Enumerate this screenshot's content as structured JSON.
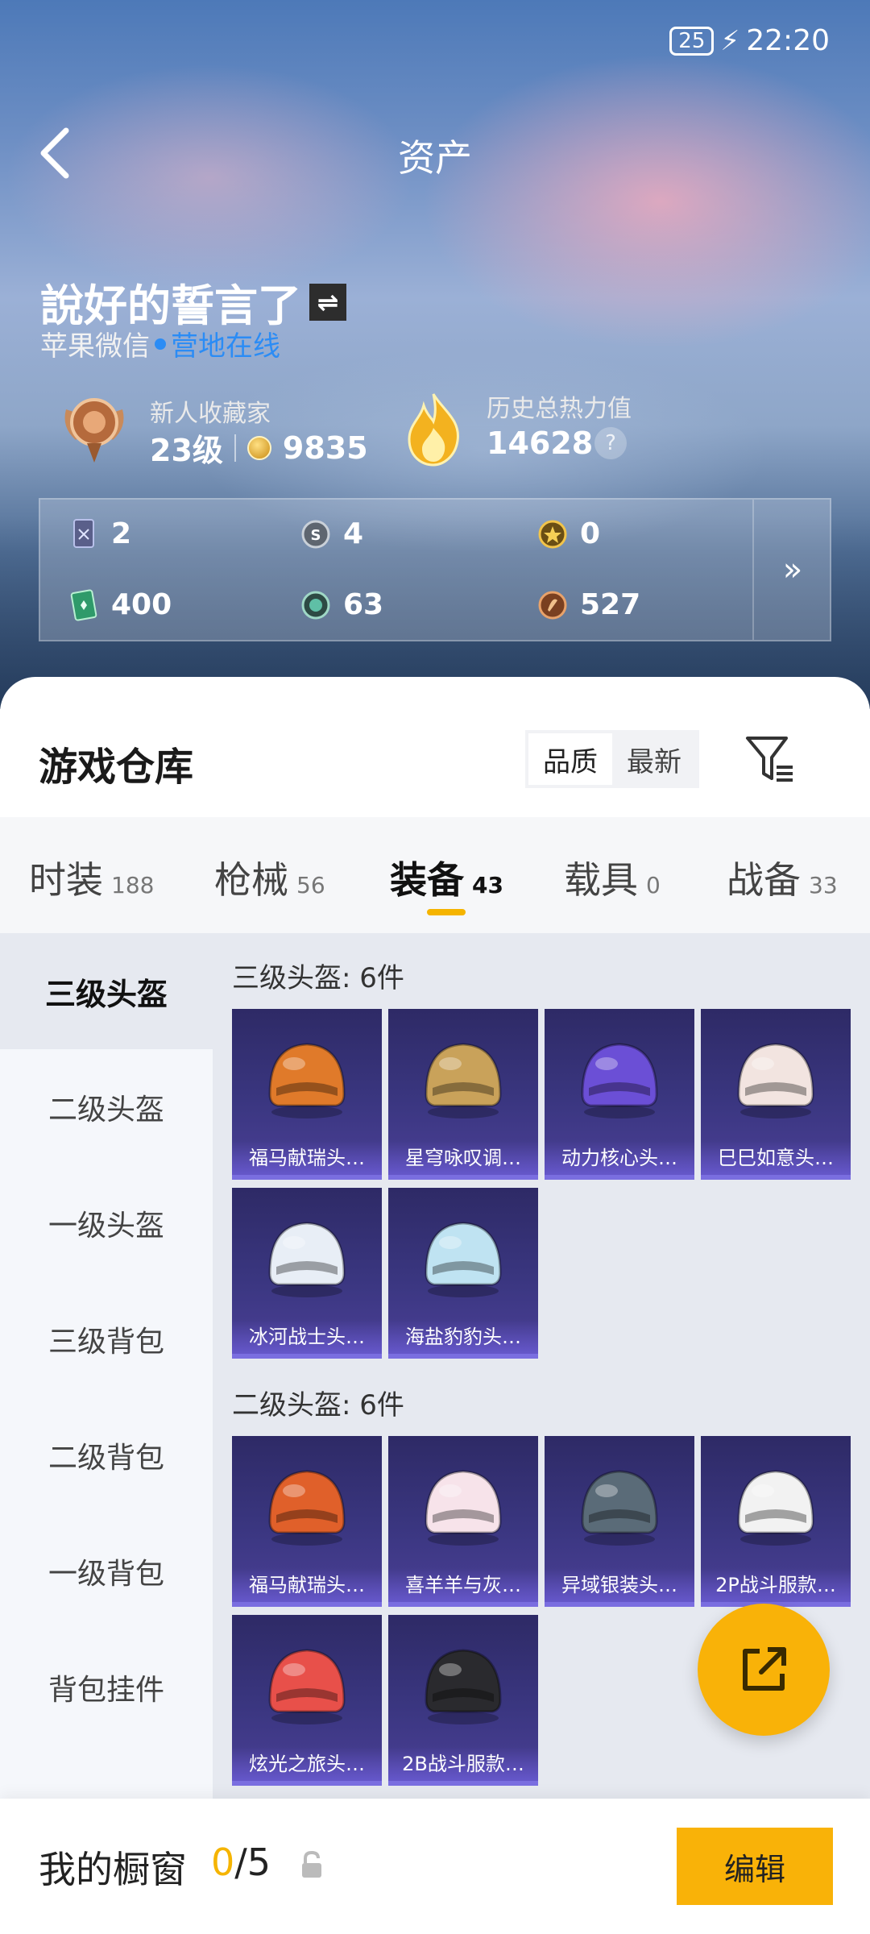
{
  "status_bar": {
    "battery": "25",
    "time": "22:20"
  },
  "header": {
    "title": "资产"
  },
  "profile": {
    "name": "說好的誓言了",
    "platform": "苹果微信",
    "online_status": "营地在线",
    "collector_title": "新人收藏家",
    "level": "23级",
    "points": "9835",
    "heat_title": "历史总热力值",
    "heat_value": "14628"
  },
  "currencies": [
    {
      "icon": "card-icon",
      "value": "2"
    },
    {
      "icon": "silver-coin-icon",
      "value": "4"
    },
    {
      "icon": "gold-star-coin-icon",
      "value": "0"
    },
    {
      "icon": "green-ticket-icon",
      "value": "400"
    },
    {
      "icon": "teal-gem-icon",
      "value": "63"
    },
    {
      "icon": "bronze-coin-icon",
      "value": "527"
    }
  ],
  "warehouse": {
    "title": "游戏仓库",
    "sort_options": [
      "品质",
      "最新"
    ],
    "active_sort": "品质"
  },
  "tabs": [
    {
      "label": "时装",
      "count": "188"
    },
    {
      "label": "枪械",
      "count": "56"
    },
    {
      "label": "装备",
      "count": "43"
    },
    {
      "label": "载具",
      "count": "0"
    },
    {
      "label": "战备",
      "count": "33"
    }
  ],
  "active_tab": "装备",
  "sidebar": [
    {
      "label": "三级头盔"
    },
    {
      "label": "二级头盔"
    },
    {
      "label": "一级头盔"
    },
    {
      "label": "三级背包"
    },
    {
      "label": "二级背包"
    },
    {
      "label": "一级背包"
    },
    {
      "label": "背包挂件"
    }
  ],
  "sections": [
    {
      "title": "三级头盔: 6件",
      "items": [
        {
          "name": "福马献瑞头…",
          "color": "#e07a2a"
        },
        {
          "name": "星穹咏叹调…",
          "color": "#c9a25a"
        },
        {
          "name": "动力核心头…",
          "color": "#6b4fd6"
        },
        {
          "name": "巳巳如意头…",
          "color": "#f2e4e0"
        },
        {
          "name": "冰河战士头…",
          "color": "#e8eef6"
        },
        {
          "name": "海盐豹豹头…",
          "color": "#bfe3f2"
        }
      ]
    },
    {
      "title": "二级头盔: 6件",
      "items": [
        {
          "name": "福马献瑞头…",
          "color": "#e0602a"
        },
        {
          "name": "喜羊羊与灰…",
          "color": "#f7e3ea"
        },
        {
          "name": "异域银装头…",
          "color": "#5a6b78"
        },
        {
          "name": "2P战斗服款…",
          "color": "#f2f2f2"
        },
        {
          "name": "炫光之旅头…",
          "color": "#e8504a"
        },
        {
          "name": "2B战斗服款…",
          "color": "#2a2a2e"
        }
      ]
    }
  ],
  "showcase": {
    "title": "我的橱窗",
    "current": "0",
    "total": "/5",
    "edit_label": "编辑"
  }
}
